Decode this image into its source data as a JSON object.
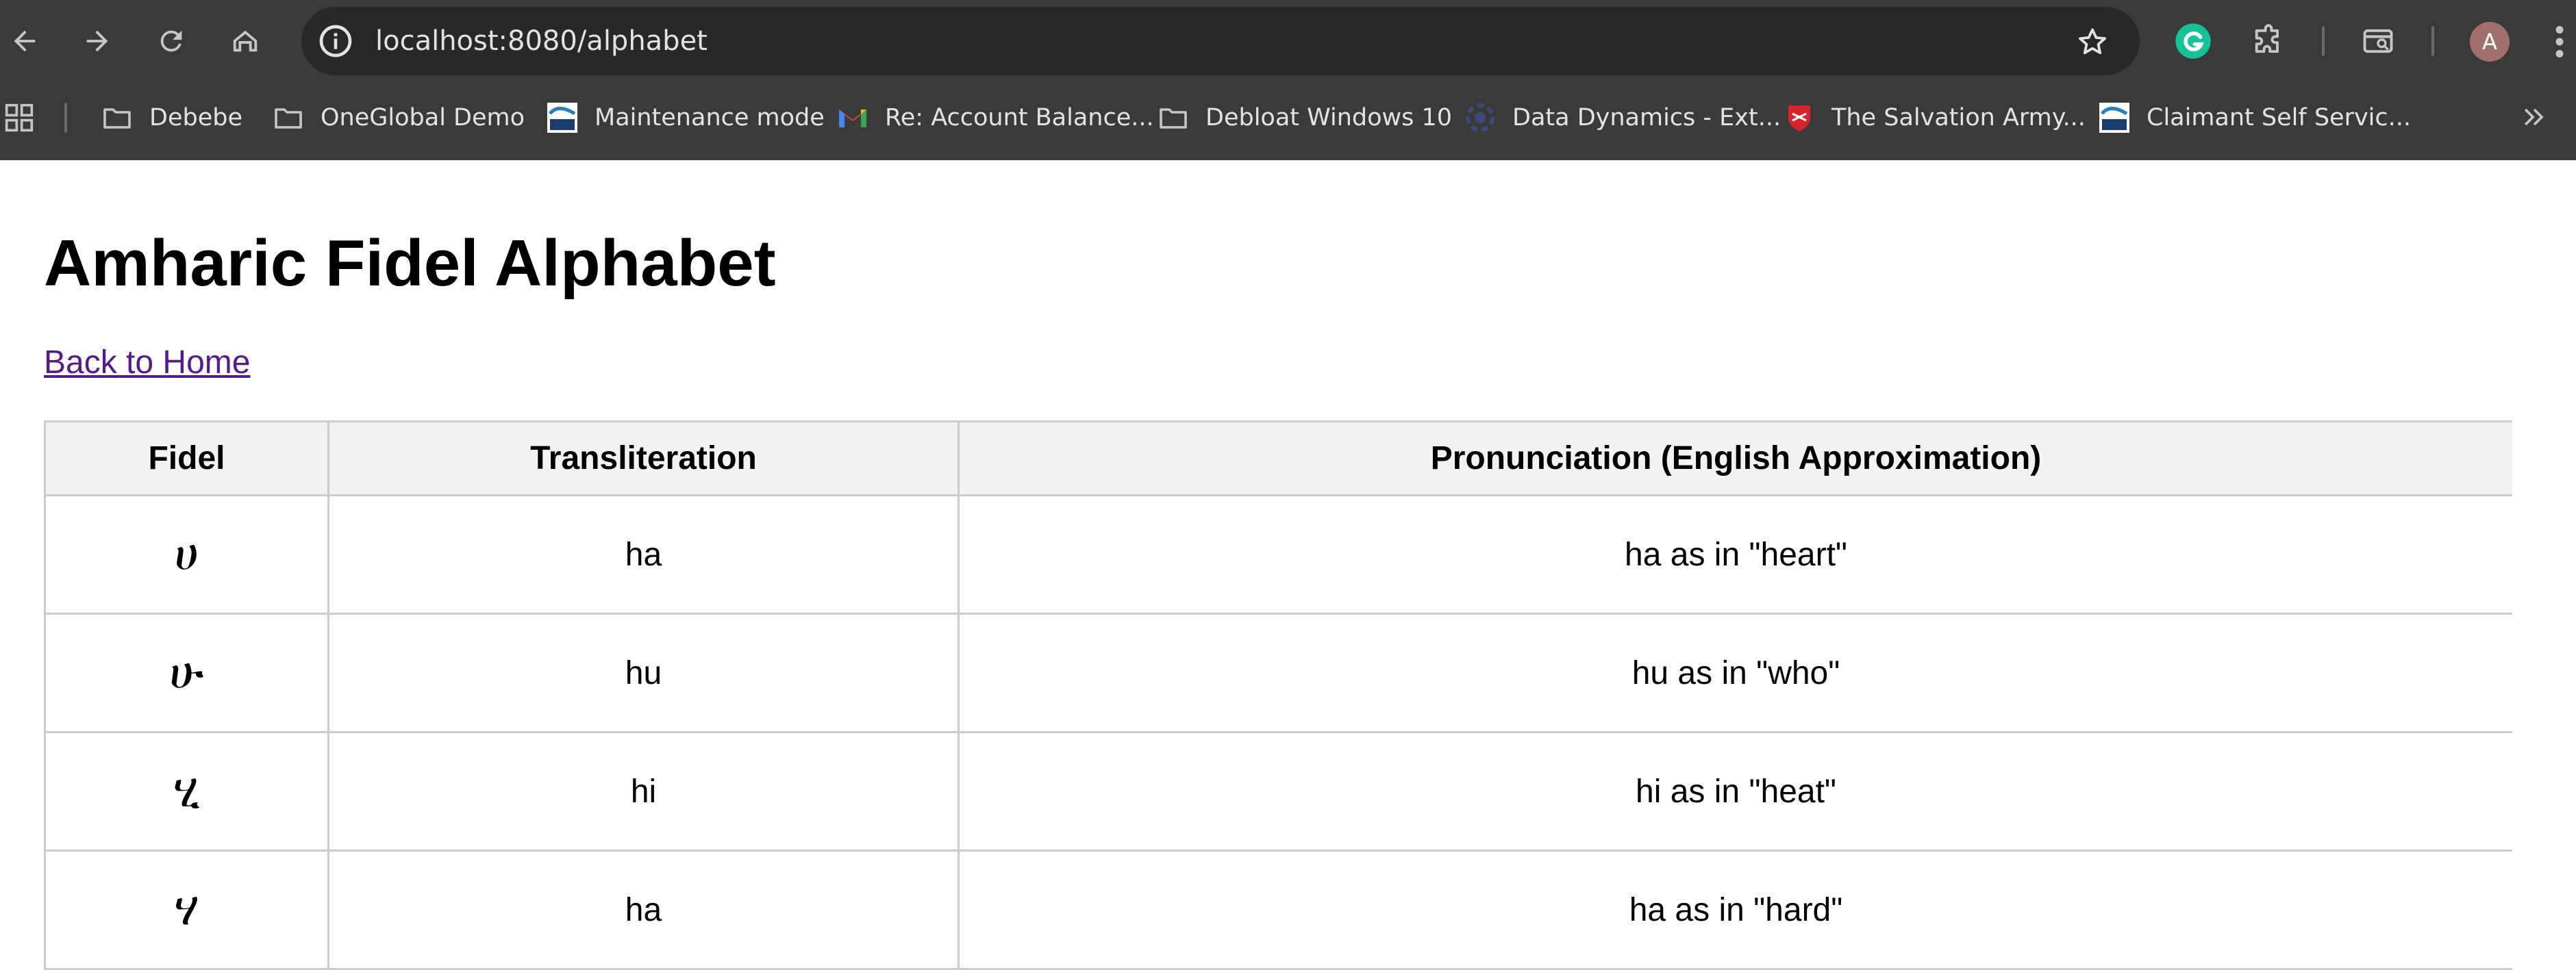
{
  "browser": {
    "url": "localhost:8080/alphabet",
    "profile_initial": "A",
    "bookmarks": [
      {
        "label": "Debebe",
        "icon": "folder-icon"
      },
      {
        "label": "OneGlobal Demo",
        "icon": "folder-icon"
      },
      {
        "label": "Maintenance mode",
        "icon": "vec-icon"
      },
      {
        "label": "Re: Account Balance...",
        "icon": "gmail-icon"
      },
      {
        "label": "Debloat Windows 10",
        "icon": "folder-icon"
      },
      {
        "label": "Data Dynamics - Ext...",
        "icon": "data-dynamics-icon"
      },
      {
        "label": "The Salvation Army...",
        "icon": "salvation-army-shield-icon"
      },
      {
        "label": "Claimant Self Servic...",
        "icon": "vec-icon"
      }
    ]
  },
  "page": {
    "title": "Amharic Fidel Alphabet",
    "back_link": "Back to Home",
    "table": {
      "headers": [
        "Fidel",
        "Transliteration",
        "Pronunciation (English Approximation)"
      ],
      "rows": [
        {
          "fidel": "ሀ",
          "translit": "ha",
          "pron": "ha as in \"heart\""
        },
        {
          "fidel": "ሁ",
          "translit": "hu",
          "pron": "hu as in \"who\""
        },
        {
          "fidel": "ሂ",
          "translit": "hi",
          "pron": "hi as in \"heat\""
        },
        {
          "fidel": "ሃ",
          "translit": "ha",
          "pron": "ha as in \"hard\""
        }
      ]
    }
  },
  "colors": {
    "chrome_bg": "#3a3a3a",
    "omnibox_bg": "#282828",
    "link_visited": "#551a8b",
    "table_border": "#cccccc",
    "header_bg": "#f2f2f2"
  }
}
